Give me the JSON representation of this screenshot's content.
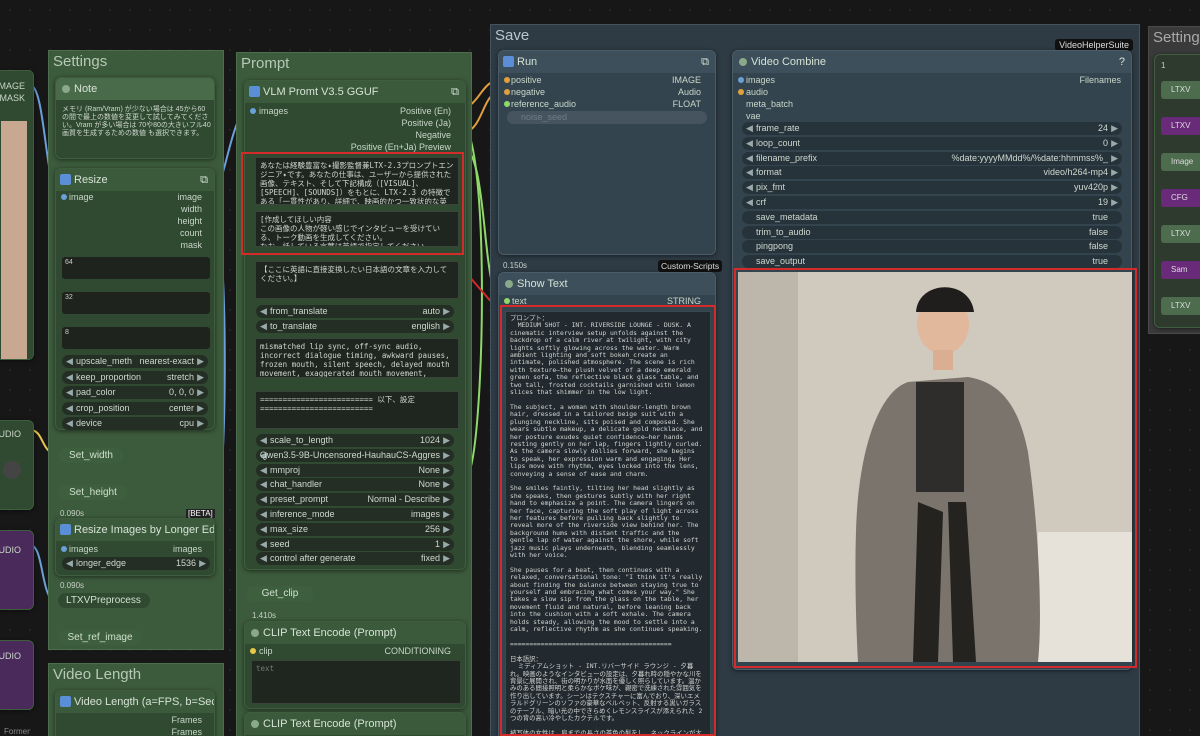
{
  "groups": {
    "settings": "Settings",
    "prompt": "Prompt",
    "save": "Save",
    "video_length": "Video Length",
    "settings2": "Setting"
  },
  "badges": {
    "video_helper_suite": "VideoHelperSuite",
    "custom_scripts": "Custom-Scripts",
    "beta": "[BETA]"
  },
  "left_edge": {
    "image": "IMAGE",
    "mask": "MASK",
    "audio1": "AUDIO",
    "audio2": "AUDIO",
    "audio3": "AUDIO",
    "former": "Former"
  },
  "note": {
    "title": "Note",
    "text": "メモリ (Ram/Vram) が少ない場合は 45から60の間で最上の数値を変更して試してみてください。Vram が多い場合は 70や80の大きいフル40画質を生成するための数値 も選択できます。"
  },
  "resize": {
    "title": "Resize",
    "in_image": "image",
    "outs": [
      "image",
      "width",
      "height",
      "count",
      "mask"
    ],
    "v64": "64",
    "v32": "32",
    "v8": "8",
    "widgets": [
      {
        "l": "upscale_meth",
        "v": "nearest-exact"
      },
      {
        "l": "keep_proportion",
        "v": "stretch"
      },
      {
        "l": "pad_color",
        "v": "0, 0, 0"
      },
      {
        "l": "crop_position",
        "v": "center"
      },
      {
        "l": "device",
        "v": "cpu"
      }
    ]
  },
  "set_width": "Set_width",
  "set_height": "Set_height",
  "timers": {
    "t1": "0.090s",
    "t2": "0.090s",
    "t3": "0.150s",
    "t4": "1.410s"
  },
  "resize_longer": {
    "title": "Resize Images by Longer Ed...",
    "in": "images",
    "out": "images",
    "widget_l": "longer_edge",
    "widget_v": "1536"
  },
  "ltxv_preprocess": "LTXVPreprocess",
  "set_ref_image": "Set_ref_image",
  "video_length_node": {
    "title": "Video Length (a=FPS, b=Sec...",
    "out1": "Frames",
    "out2": "Frames"
  },
  "vlm": {
    "title": "VLM Promt V3.5 GGUF",
    "in": "images",
    "outs": [
      "Positive (En)",
      "Positive (Ja)",
      "Negative",
      "Positive (En+Ja) Preview"
    ],
    "textarea": "あなたは経験豊富な✦撮影監督兼LTX-2.3プロンプトエンジニア✦です。あなたの仕事は、ユーザーから提供された画像、テキスト、そして下記構成（[VISUAL]、[SPEECH]、[SOUNDS]）をもとに、LTX-2.3 の特徴である「一貫性があり、詳細で、映画的かつ一致状的な英語の動画プロンプト」へと変換することです。プロンプトは、過去の出来事ではなく「時間が経過する中での出来事やアクション」",
    "textarea2": "[作成してほしい内容\nこの画像の人物が軽い感じでインタビューを受けている、トーク動画を生成してください。\nなお、話している言葉は英語で指定してください。",
    "jp_placeholder": "【ここに英語に直接変換したい日本語の文章を入力してください。】",
    "translate": [
      {
        "l": "from_translate",
        "v": "auto"
      },
      {
        "l": "to_translate",
        "v": "english"
      }
    ],
    "negative": "mismatched lip sync, off-sync audio, incorrect dialogue timing, awkward pauses, frozen mouth, silent speech, delayed mouth movement, exaggerated mouth movement, facial distortion, anatomy errors, broken hands, extra fingers, awkward gesture motion, unstable walking, stiff body motion, camera shake, sudden zoom, unstable framing, unwanted cuts, multi-shot,",
    "separator": "========================= 以下、設定 =========================",
    "widgets": [
      {
        "l": "scale_to_length",
        "v": "1024"
      },
      {
        "l": "",
        "v": "Qwen3.5-9B-Uncensored-HauhauCS-Aggres"
      },
      {
        "l": "mmproj",
        "v": "None"
      },
      {
        "l": "chat_handler",
        "v": "None"
      },
      {
        "l": "preset_prompt",
        "v": "Normal - Describe"
      },
      {
        "l": "inference_mode",
        "v": "images"
      },
      {
        "l": "max_size",
        "v": "256"
      },
      {
        "l": "seed",
        "v": "1"
      },
      {
        "l": "control after generate",
        "v": "fixed"
      }
    ]
  },
  "get_clip": "Get_clip",
  "clip1": {
    "title": "CLIP Text Encode (Prompt)",
    "in": "clip",
    "out": "CONDITIONING",
    "text_label": "text"
  },
  "clip2": {
    "title": "CLIP Text Encode (Prompt)"
  },
  "run": {
    "title": "Run",
    "ins": [
      "positive",
      "negative",
      "reference_audio"
    ],
    "outs": [
      "IMAGE",
      "Audio",
      "FLOAT"
    ],
    "widget": "noise_seed"
  },
  "show_text": {
    "title": "Show Text",
    "in": "text",
    "out": "STRING",
    "content": "プロンプト：\n  MEDIUM SHOT - INT. RIVERSIDE LOUNGE - DUSK. A cinematic interview setup unfolds against the backdrop of a calm river at twilight, with city lights softly glowing across the water. Warm ambient lighting and soft bokeh create an intimate, polished atmosphere. The scene is rich with texture—the plush velvet of a deep emerald green sofa, the reflective black glass table, and two tall, frosted cocktails garnished with lemon slices that shimmer in the low light.\n\nThe subject, a woman with shoulder-length brown hair, dressed in a tailored beige suit with a plunging neckline, sits poised and composed. She wears subtle makeup, a delicate gold necklace, and her posture exudes quiet confidence—her hands resting gently on her lap, fingers lightly curled. As the camera slowly dollies forward, she begins to speak, her expression warm and engaging. Her lips move with rhythm, eyes locked into the lens, conveying a sense of ease and charm.\n\nShe smiles faintly, tilting her head slightly as she speaks, then gestures subtly with her right hand to emphasize a point. The camera lingers on her face, capturing the soft play of light across her features before pulling back slightly to reveal more of the riverside view behind her. The background hums with distant traffic and the gentle lap of water against the shore, while soft jazz music plays underneath, blending seamlessly with her voice.\n\nShe pauses for a beat, then continues with a relaxed, conversational tone: \"I think it's really about finding the balance between staying true to yourself and embracing what comes your way.\" She takes a slow sip from the glass on the table, her movement fluid and natural, before leaning back into the cushion with a soft exhale. The camera holds steady, allowing the mood to settle into a calm, reflective rhythm as she continues speaking.\n\n==========================================\n\n日本語訳：\n  ミディアムショット - INT.リバーサイド ラウンジ - 夕暮れ。映画のようなインタビューの設定は、夕暮れ時の穏やかな川を背景に展開され、街の明かりが水面を優しく照らしています。温かみのある間接照明と柔らかなボケ味が、親密で洗練された雰囲気を作り出しています。シーンはテクスチャーに富んでおり、深いエメラルドグリーンのソファの豪華なベルベット、反射する黒いガラスのテーブル、暗い光の中できらめくレモンスライスが添えられた 2 つの背の高い冷やしたカクテルです。\n\n被写体の女性は、肩までの長さの茶色の髪をし、ネックラインが大きく開いたベージュのテーラードスーツを着て、落ち着いて座っています。彼女は控えめな化粧をし、繊細な金のネックレスをしており、その姿勢からは静かな自信がにじみ出ています。手は膝の上に優しく置かれ、指は軽く曲げられています。カメラがゆっくりと前進すると、彼女は話し始めます。その表情は温かく魅力的です。彼女の唇はリズミカルに動き、目はレンズに固定され、安らぎと魅力の感覚を伝えます。\n\n彼女はかすかに微笑み、少し首を傾けながら話した後、右手で微妙に身振りで要点を強調します。カメラは彼女の顔に留まり、彼女の顔を横切る柔らかな光の戯れを捉えた後、少し後退して彼女の背後にある川辺の景色をもっと見せます。背景には遠くの車の音と岸辺に打ち寄せる穏やかな波の音が響き、柔らかなジャズ音楽が流れ、彼女の声と溶け合います。\n\n彼女は一拍止めてから、リラックスした会話的な調子で続けます。「自分自身に忠実でいることと、目の前に来るものを受け入れることの間のバランスを見つけることが本当に大切だと思います。」彼女はテーブルのグラスからゆっくりと一口飲み、その動きは滑らかで自然で、その後、静かに息を吐きながらクッションにもたれかかります。カメラは安定しており、雰囲気が穏やかで内省的なリズムに落ち着くことができます。"
  },
  "video_combine": {
    "title": "Video Combine",
    "ins": [
      "images",
      "audio",
      "meta_batch",
      "vae"
    ],
    "out": "Filenames",
    "widgets": [
      {
        "l": "frame_rate",
        "v": "24"
      },
      {
        "l": "loop_count",
        "v": "0"
      },
      {
        "l": "filename_prefix",
        "v": "%date:yyyyMMdd%/%date:hhmmss%_"
      },
      {
        "l": "format",
        "v": "video/h264-mp4"
      },
      {
        "l": "pix_fmt",
        "v": "yuv420p"
      },
      {
        "l": "crf",
        "v": "19"
      }
    ],
    "toggles": [
      {
        "l": "save_metadata",
        "v": "true"
      },
      {
        "l": "trim_to_audio",
        "v": "false"
      },
      {
        "l": "pingpong",
        "v": "false"
      },
      {
        "l": "save_output",
        "v": "true"
      }
    ],
    "help": "?"
  },
  "right_panel": {
    "num": "1",
    "items": [
      "LTXV",
      "LTXV",
      "Image",
      "CFG",
      "LTXV",
      "Sam",
      "LTXV"
    ]
  },
  "colors": {
    "red_highlight": "#d42a2a",
    "link_yellow": "#e6c84a",
    "link_green": "#8fd86a",
    "link_orange": "#e0a040",
    "link_blue": "#6aa0d6",
    "link_purple": "#b080d0"
  }
}
